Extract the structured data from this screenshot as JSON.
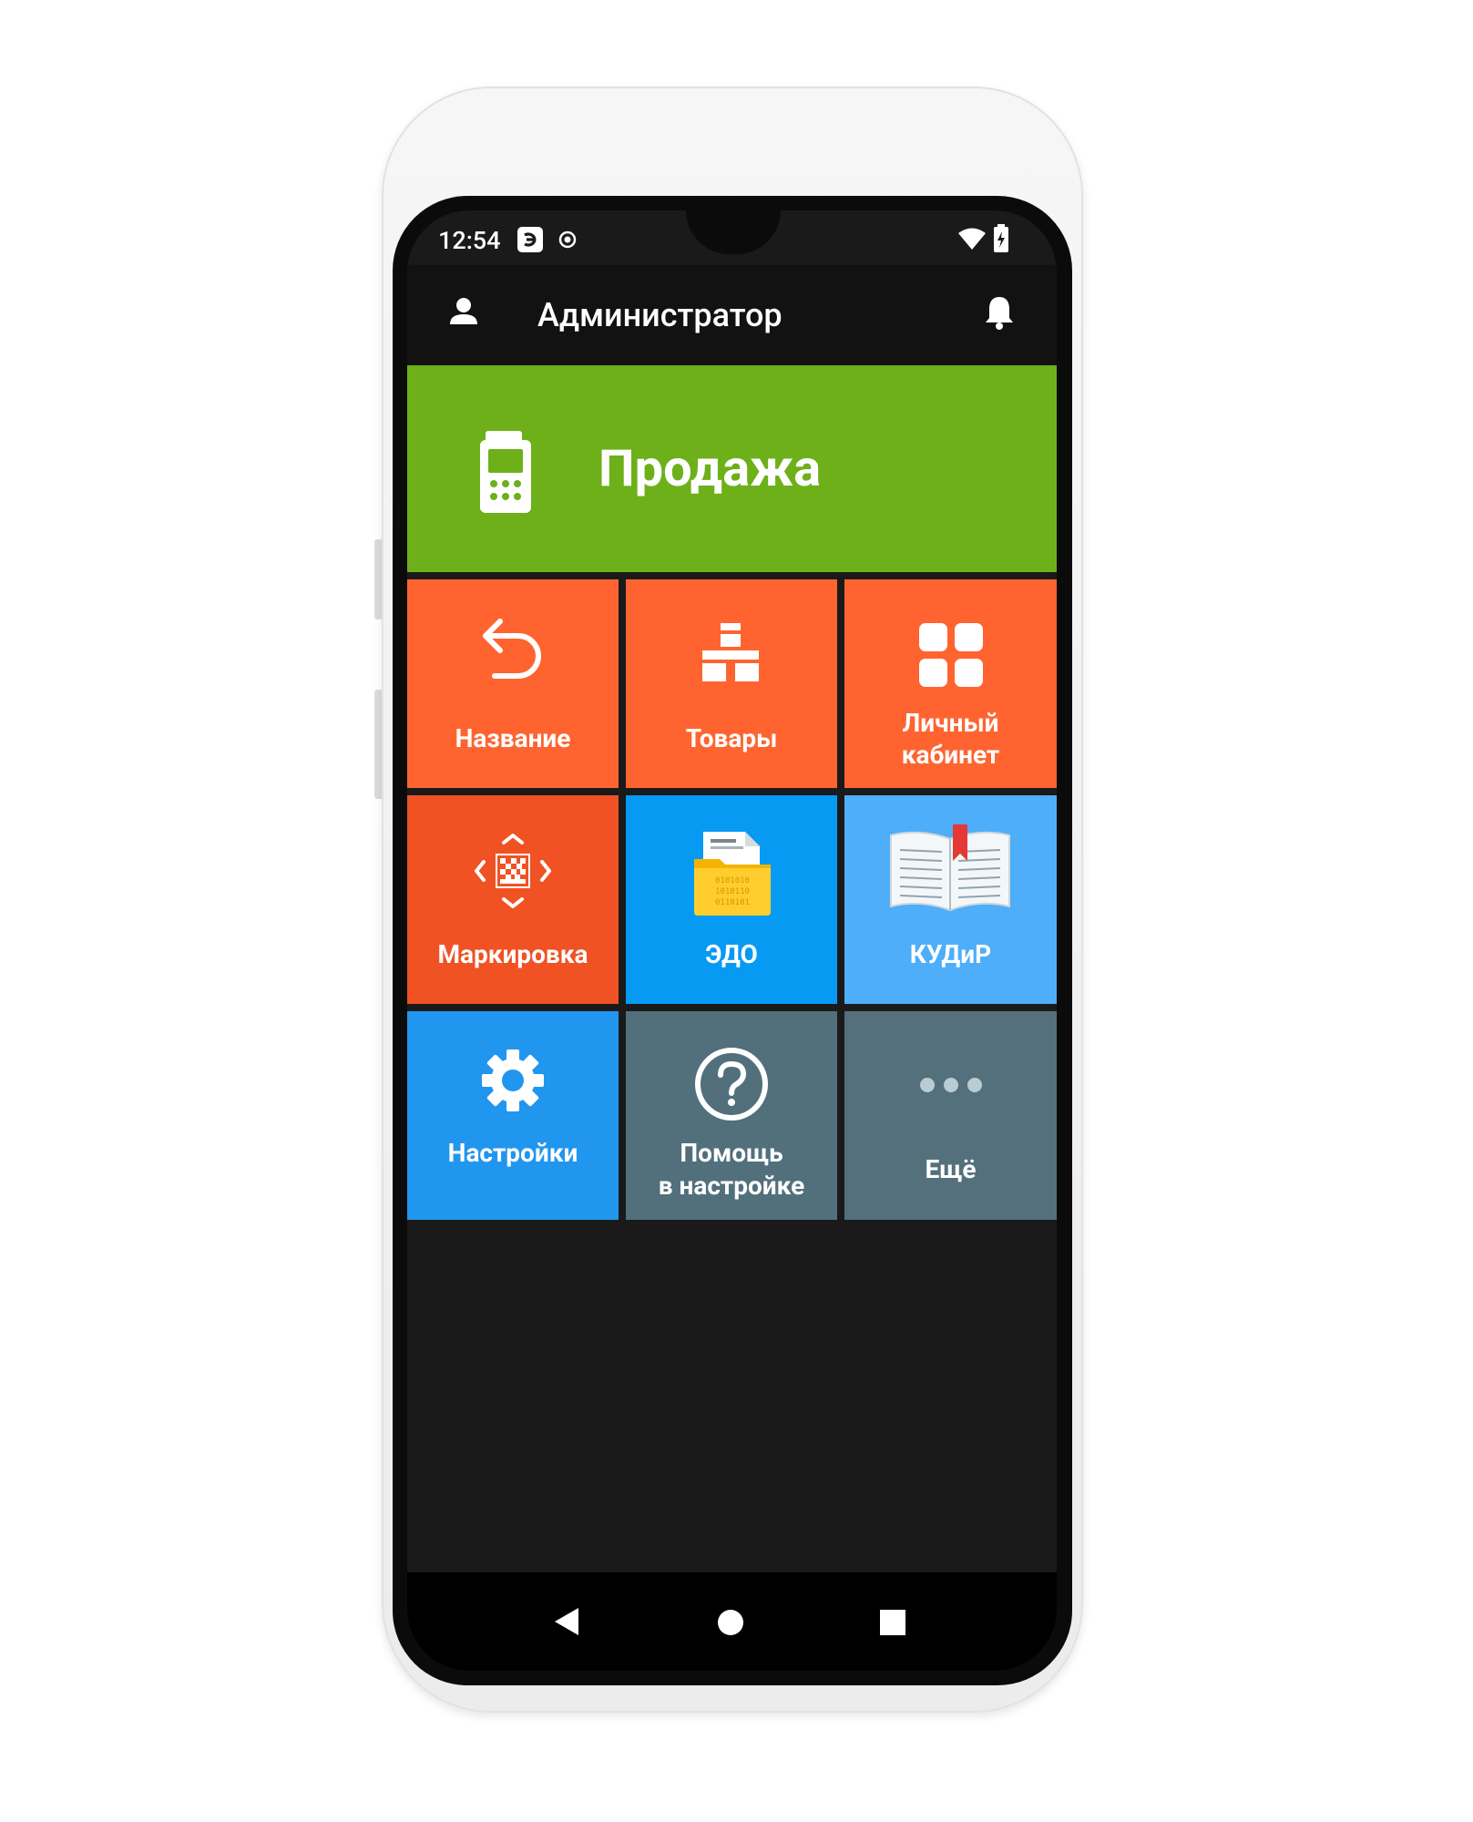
{
  "status_bar": {
    "time": "12:54",
    "icons": [
      "app-e-icon",
      "circle-dot-icon",
      "wifi-icon",
      "battery-icon"
    ]
  },
  "app_bar": {
    "title": "Администратор",
    "left_icon": "user-icon",
    "right_icon": "bell-icon"
  },
  "sale": {
    "label": "Продажа",
    "icon": "pos-terminal-icon",
    "color": "#6db01a"
  },
  "tiles": [
    {
      "label": "Название",
      "icon": "undo-arrow-icon",
      "color": "#ff6430"
    },
    {
      "label": "Товары",
      "icon": "stacked-boxes-icon",
      "color": "#ff6430"
    },
    {
      "label_line1": "Личный",
      "label_line2": "кабинет",
      "icon": "grid-squares-icon",
      "color": "#ff6430"
    },
    {
      "label": "Маркировка",
      "icon": "datamatrix-scan-icon",
      "color": "#f05224"
    },
    {
      "label": "ЭДО",
      "icon": "folder-documents-icon",
      "color": "#069af3"
    },
    {
      "label": "КУДиР",
      "icon": "open-book-icon",
      "color": "#4eaef9"
    },
    {
      "label": "Настройки",
      "icon": "gear-icon",
      "color": "#2196ef"
    },
    {
      "label_line1": "Помощь",
      "label_line2": "в настройке",
      "icon": "help-circle-icon",
      "color": "#52707c"
    },
    {
      "label": "Ещё",
      "icon": "more-dots-icon",
      "color": "#54707c"
    }
  ],
  "nav_bar": {
    "buttons": [
      "back-icon",
      "home-icon",
      "recents-icon"
    ]
  }
}
